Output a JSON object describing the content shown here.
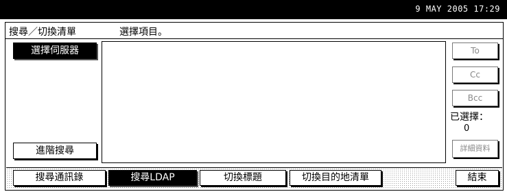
{
  "status_bar": {
    "datetime": "9 MAY  2005 17:29"
  },
  "header": {
    "title": "搜尋／切換清單",
    "instruction": "選擇項目。"
  },
  "left_panel": {
    "select_server_label": "選擇伺服器",
    "advanced_search_label": "進階搜尋"
  },
  "right_panel": {
    "to_label": "To",
    "cc_label": "Cc",
    "bcc_label": "Bcc",
    "selected_label": "已選擇：",
    "selected_count": "0",
    "details_label": "詳細資料"
  },
  "tabs": [
    {
      "label": "搜尋通訊錄",
      "selected": false
    },
    {
      "label": "搜尋LDAP",
      "selected": true
    },
    {
      "label": "切換標題",
      "selected": false
    },
    {
      "label": "切換目的地清單",
      "selected": false
    }
  ],
  "exit_label": "結束",
  "colors": {
    "selected_bg": "#000000",
    "disabled_text": "#888888"
  }
}
